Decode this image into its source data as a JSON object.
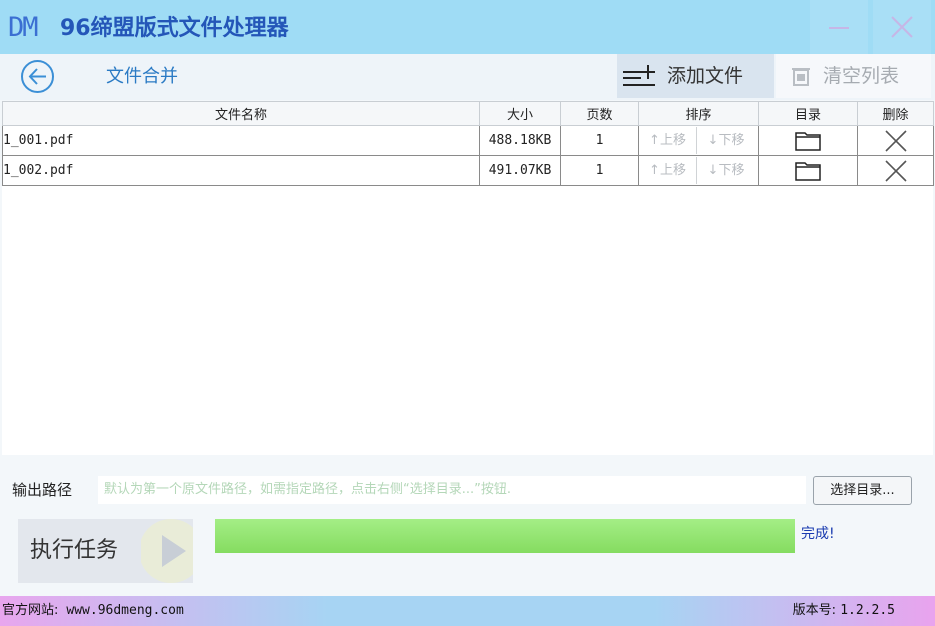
{
  "app": {
    "logo": "DM",
    "title": "96缔盟版式文件处理器",
    "colors": {
      "titlebar": "#9fdcf5",
      "accent": "#2a7ac4",
      "progress": "#8ee26a"
    }
  },
  "toolbar": {
    "section_title": "文件合并",
    "add_file_label": "添加文件",
    "clear_list_label": "清空列表"
  },
  "table": {
    "headers": {
      "name": "文件名称",
      "size": "大小",
      "pages": "页数",
      "sort": "排序",
      "dir": "目录",
      "delete": "删除"
    },
    "rows": [
      {
        "name": "1_001.pdf",
        "size": "488.18KB",
        "pages": "1",
        "up": "↑上移",
        "down": "↓下移"
      },
      {
        "name": "1_002.pdf",
        "size": "491.07KB",
        "pages": "1",
        "up": "↑上移",
        "down": "↓下移"
      }
    ]
  },
  "output": {
    "label": "输出路径",
    "placeholder": "默认为第一个原文件路径，如需指定路径，点击右侧“选择目录...”按钮.",
    "choose_button": "选择目录..."
  },
  "task": {
    "run_label": "执行任务",
    "progress_percent": 100,
    "status": "完成!"
  },
  "footer": {
    "site_label": "官方网站:",
    "site_url": "www.96dmeng.com",
    "version_label": "版本号:",
    "version": "1.2.2.5"
  }
}
